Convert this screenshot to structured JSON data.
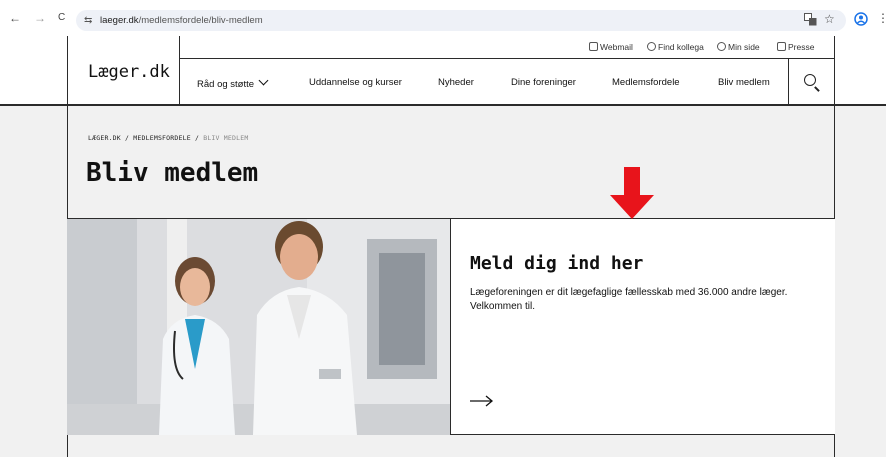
{
  "browser": {
    "url_host": "laeger.dk",
    "url_path": "/medlemsfordele/bliv-medlem",
    "back_glyph": "←",
    "forward_glyph": "→",
    "reload_glyph": "C",
    "site_glyph": "⇆",
    "star_glyph": "☆",
    "menu_glyph": "⋮"
  },
  "header": {
    "logo": "Læger.dk",
    "utility": [
      {
        "label": "Webmail",
        "icon": "mail-icon"
      },
      {
        "label": "Find kollega",
        "icon": "help-circle-icon"
      },
      {
        "label": "Min side",
        "icon": "user-circle-icon"
      },
      {
        "label": "Presse",
        "icon": "document-icon"
      }
    ],
    "nav": {
      "raad": "Råd og støtte",
      "uddannelse": "Uddannelse og kurser",
      "nyheder": "Nyheder",
      "foreninger": "Dine foreninger",
      "medlemsfordele": "Medlemsfordele",
      "bliv": "Bliv medlem"
    }
  },
  "breadcrumb": {
    "home": "LÆGER.DK",
    "sep1": " / ",
    "section": "MEDLEMSFORDELE",
    "sep2": " / ",
    "current": "BLIV MEDLEM"
  },
  "page_title": "Bliv medlem",
  "card": {
    "title": "Meld dig ind her",
    "text": "Lægeforeningen er dit lægefaglige fællesskab med 36.000 andre læger. Velkommen til."
  },
  "colors": {
    "accent_arrow": "#e8141b",
    "border": "#2b2b2b",
    "page_bg": "#f1f1f1"
  }
}
